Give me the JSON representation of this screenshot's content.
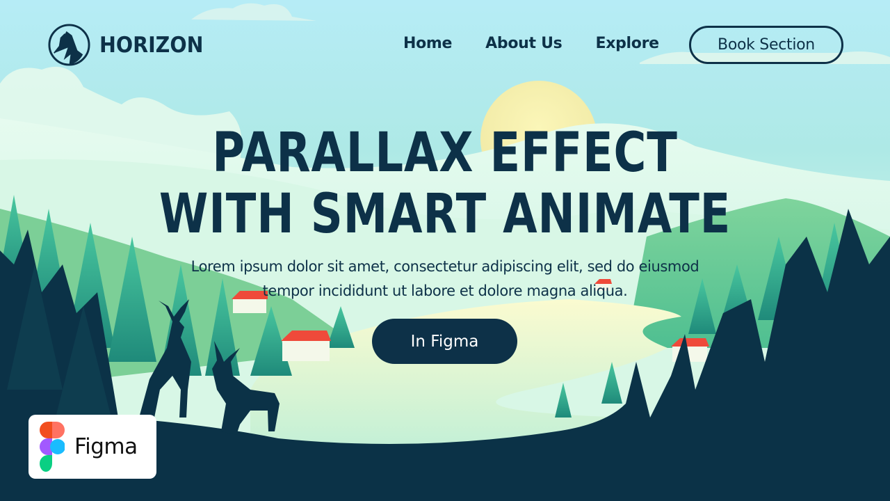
{
  "brand": {
    "name": "HORIZON",
    "logo_icon": "mountain-circle-icon"
  },
  "nav": {
    "links": [
      "Home",
      "About Us",
      "Explore"
    ],
    "cta_label": "Book Section"
  },
  "hero": {
    "title_line1": "PARALLAX EFFECT",
    "title_line2": "WITH SMART ANIMATE",
    "description_line1": "Lorem ipsum dolor sit amet, consectetur adipiscing elit, sed do eiusmod",
    "description_line2": "tempor incididunt ut labore et dolore magna aliqua.",
    "button_label": "In Figma"
  },
  "badge": {
    "label": "Figma",
    "icon": "figma-logo-icon"
  },
  "colors": {
    "primary": "#0d3148",
    "sky": "#b6ecf6",
    "sun": "#f7f1b0",
    "forest_dark": "#0b3247",
    "forest_mid": "#2aa58a",
    "roof": "#ef4a3a"
  }
}
